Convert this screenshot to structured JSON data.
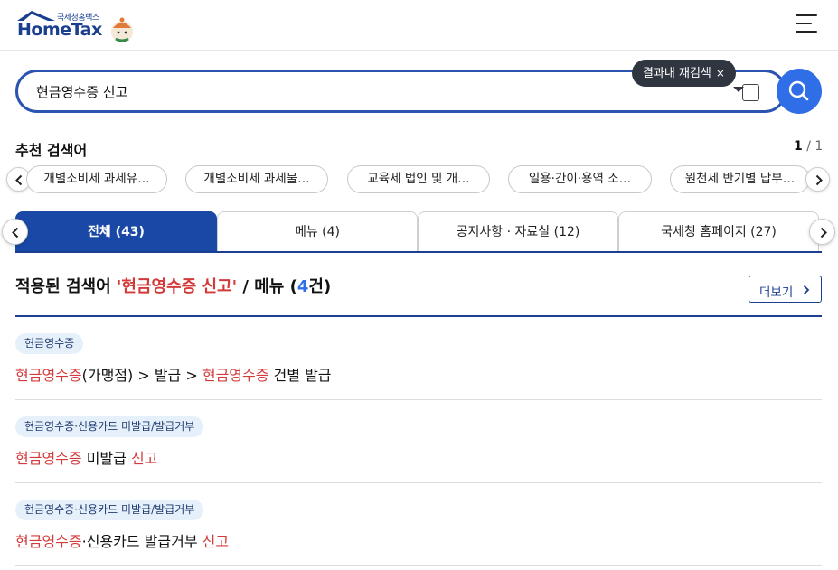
{
  "header": {
    "logo_sub": "국세청홈택스",
    "logo_text": "HomeTax"
  },
  "search": {
    "query": "현금영수증 신고",
    "recheck_tooltip": "결과내 재검색",
    "recheck_close": "×"
  },
  "recommended": {
    "title": "추천 검색어",
    "page_current": "1",
    "page_total": "/ 1",
    "chips": [
      "개별소비세 과세유…",
      "개별소비세 과세물…",
      "교육세 법인 및 개…",
      "일용·간이·용역 소…",
      "원천세 반기별 납부…"
    ]
  },
  "tabs": [
    {
      "label": "전체 (43)",
      "active": true
    },
    {
      "label": "메뉴 (4)",
      "active": false
    },
    {
      "label": "공지사항 · 자료실 (12)",
      "active": false
    },
    {
      "label": "국세청 홈페이지 (27)",
      "active": false
    }
  ],
  "result": {
    "prefix": "적용된 검색어 ",
    "query": "'현금영수증 신고'",
    "middle": " / 메뉴 (",
    "count": "4",
    "suffix": "건)",
    "more_label": "더보기"
  },
  "items": [
    {
      "tag": "현금영수증",
      "parts": [
        {
          "text": "현금영수증",
          "hl": true
        },
        {
          "text": "(가맹점) > 발급 > ",
          "hl": false
        },
        {
          "text": "현금영수증",
          "hl": true
        },
        {
          "text": " 건별 발급",
          "hl": false
        }
      ]
    },
    {
      "tag": "현금영수증·신용카드 미발급/발급거부",
      "parts": [
        {
          "text": "현금영수증",
          "hl": true
        },
        {
          "text": " 미발급 ",
          "hl": false
        },
        {
          "text": "신고",
          "hl": true
        }
      ]
    },
    {
      "tag": "현금영수증·신용카드 미발급/발급거부",
      "parts": [
        {
          "text": "현금영수증",
          "hl": true
        },
        {
          "text": "·신용카드 발급거부 ",
          "hl": false
        },
        {
          "text": "신고",
          "hl": true
        }
      ]
    }
  ],
  "colors": {
    "brand": "#1a3f8f",
    "accent": "#2f6ee6",
    "highlight": "#d33b3b"
  }
}
